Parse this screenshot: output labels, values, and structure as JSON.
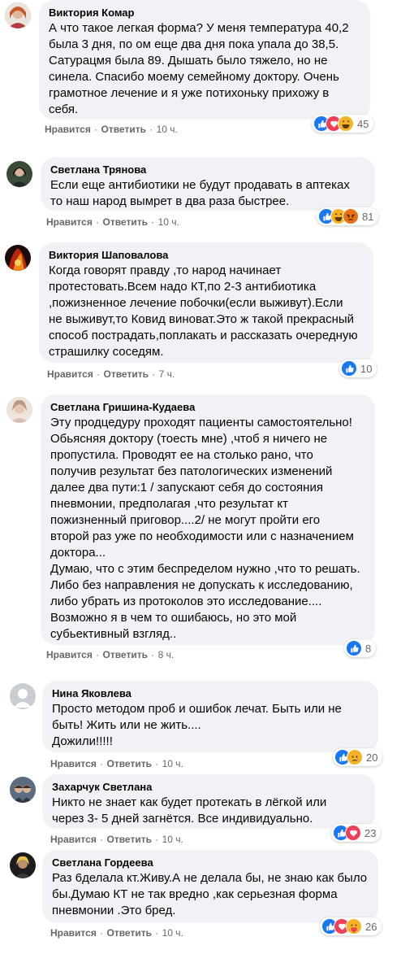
{
  "common": {
    "like_label": "Нравится",
    "reply_label": "Ответить",
    "separator": "·"
  },
  "comments": [
    {
      "author": "Виктория Комар",
      "text": "А что такое легкая форма? У меня температура 40,2\nбыла 3 дня, по ом еще два дня пока упала до 38,5.\nСатурацмя была 89. Дышать было тяжело, но не\nсинела. Спасибо моему семейному доктору. Очень\nграмотное лечение и я уже потихоньку прихожу в\nсебя.",
      "time": "10 ч.",
      "reactions": [
        "like-icon",
        "love-icon",
        "haha-icon"
      ],
      "reaction_count": "45",
      "avatar_color": "#c45a2c"
    },
    {
      "author": "Светлана Трянова",
      "text": "Если еще антибиотики не будут продавать в аптеках\nто наш народ вымрет в два раза быстрее.",
      "time": "10 ч.",
      "reactions": [
        "like-icon",
        "haha-icon",
        "angry-icon"
      ],
      "reaction_count": "81",
      "avatar_color": "#3a4a38"
    },
    {
      "author": "Виктория Шаповалова",
      "text": "Когда говорят правду ,то народ начинает\nпротестовать.Всем надо КТ,по 2-3 антибиотика\n,пожизненное лечение побочки(если выживут).Если\nне выживут,то Ковид виноват.Это ж такой прекрасный\nспособ пострадать,поплакать и рассказать очередную\nстрашилку соседям.",
      "time": "7 ч.",
      "reactions": [
        "like-icon"
      ],
      "reaction_count": "10",
      "avatar_color": "#b8260f"
    },
    {
      "author": "Светлана Гришина-Кудаева",
      "text": "Эту продцедуру проходят пациенты самостоятельно!\nОбьясняя доктору   (тоесть мне)   ,чтоб я ничего не\nпропустила. Проводят ее на столько рано, что\nполучив результат без патологических изменений\nдалее два пути:1 / запускают себя до состояния\nпневмонии, предполагая ,что результат кт\nпожизненный приговор....2/ не могут пройти его\nвторой раз уже по необходимости или с назначением\nдоктора...\nДумаю, что с этим беспределом нужно ,что то решать.\nЛибо без направления не допускать к исследованию,\nлибо убрать из протоколов это исследование....\nВозможно я в чем то ошибаюсь, но это мой\nсубьективный взгляд..",
      "time": "8 ч.",
      "reactions": [
        "like-icon"
      ],
      "reaction_count": "8",
      "avatar_color": "#d9c2b4"
    },
    {
      "author": "Нина Яковлева",
      "text": "Просто методом проб и ошибок лечат. Быть или не\nбыть! Жить или не жить....\nДожили!!!!!",
      "time": "10 ч.",
      "reactions": [
        "like-icon",
        "sad-icon"
      ],
      "reaction_count": "20",
      "avatar_color": "#c9ccd1"
    },
    {
      "author": "Захарчук Светлана",
      "text": "Никто не знает как будет протекать в лёгкой или\nчерез 3- 5 дней загнётся. Все индивидуально.",
      "time": "10 ч.",
      "reactions": [
        "like-icon",
        "love-icon"
      ],
      "reaction_count": "23",
      "avatar_color": "#2e3642"
    },
    {
      "author": "Светлана Гордеева",
      "text": "Раз 6делала кт.Живу.А не делала бы, не знаю как было\nбы.Думаю КТ не так вредно ,как серьезная форма\nпневмонии .Это бред.",
      "time": "10 ч.",
      "reactions": [
        "like-icon",
        "love-icon",
        "care-icon"
      ],
      "reaction_count": "26",
      "avatar_color": "#1c1c1c"
    }
  ]
}
